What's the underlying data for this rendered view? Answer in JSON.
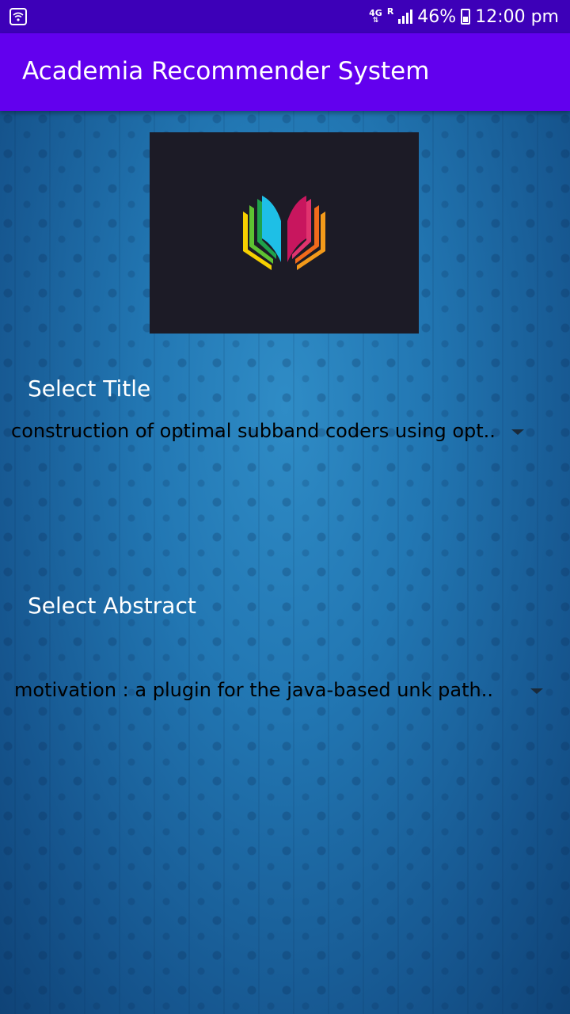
{
  "status_bar": {
    "network": "4G",
    "network_sub": "R",
    "battery": "46%",
    "time": "12:00 pm",
    "icons": [
      "wifi-icon",
      "signal-icon",
      "battery-icon"
    ]
  },
  "app_bar": {
    "title": "Academia Recommender System",
    "color": "#6200ee"
  },
  "logo": {
    "icon": "book-logo-icon",
    "background": "#1c1b26"
  },
  "title_section": {
    "label": "Select Title",
    "selected": "construction of optimal subband coders using opt.."
  },
  "abstract_section": {
    "label": "Select Abstract",
    "selected": "motivation : a plugin for the java-based unk path.."
  }
}
